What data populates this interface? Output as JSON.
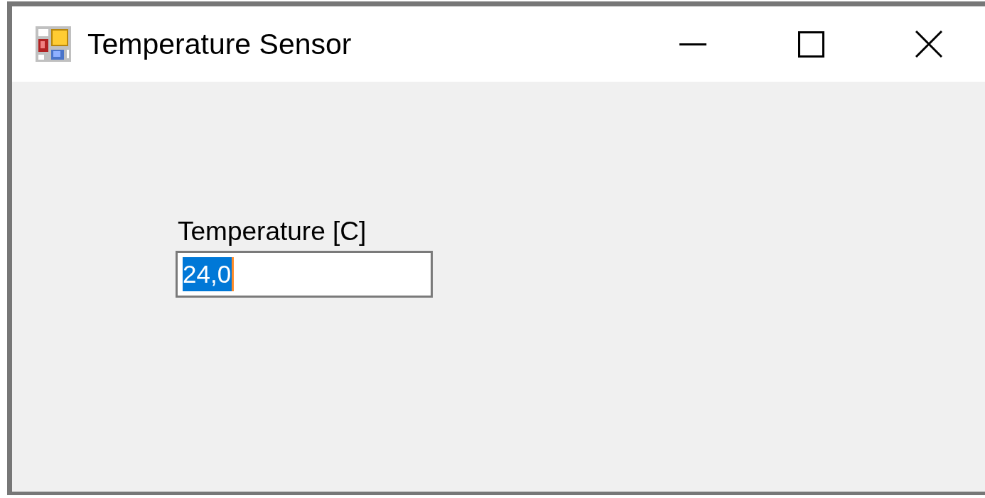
{
  "window": {
    "title": "Temperature Sensor"
  },
  "form": {
    "label": "Temperature [C]",
    "field": {
      "value": "24,0",
      "text_selected": true
    }
  }
}
